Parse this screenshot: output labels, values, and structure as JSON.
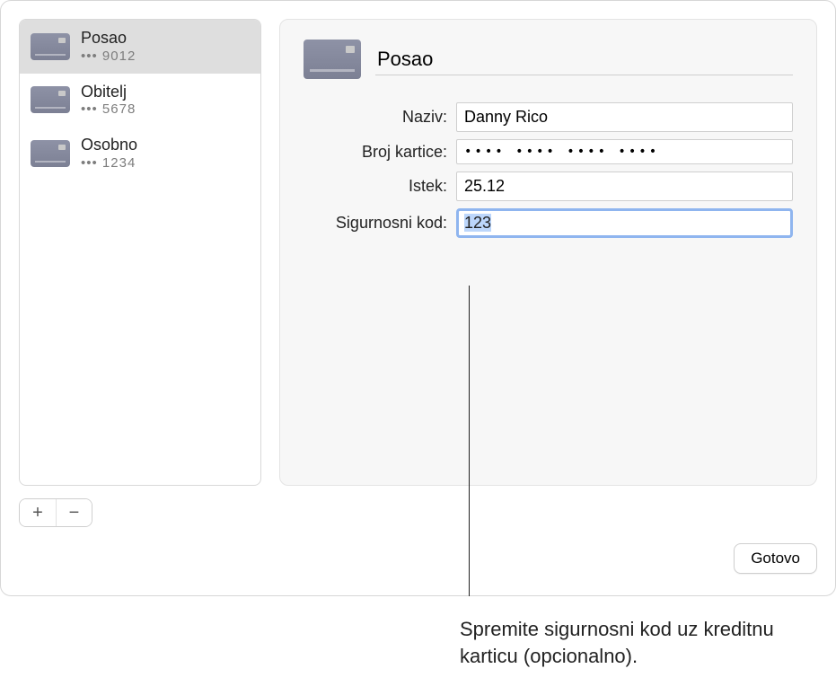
{
  "sidebar": {
    "items": [
      {
        "title": "Posao",
        "masked": "••• 9012",
        "selected": true
      },
      {
        "title": "Obitelj",
        "masked": "••• 5678",
        "selected": false
      },
      {
        "title": "Osobno",
        "masked": "••• 1234",
        "selected": false
      }
    ],
    "add_label": "+",
    "remove_label": "−"
  },
  "detail": {
    "title_value": "Posao",
    "fields": {
      "name": {
        "label": "Naziv:",
        "value": "Danny Rico"
      },
      "number": {
        "label": "Broj kartice:",
        "value": "•••• •••• •••• ••••"
      },
      "expiry": {
        "label": "Istek:",
        "value": "25.12"
      },
      "security": {
        "label": "Sigurnosni kod:",
        "value": "123"
      }
    }
  },
  "footer": {
    "done_label": "Gotovo"
  },
  "callout": {
    "text": "Spremite sigurnosni kod uz kreditnu karticu (opcionalno)."
  }
}
